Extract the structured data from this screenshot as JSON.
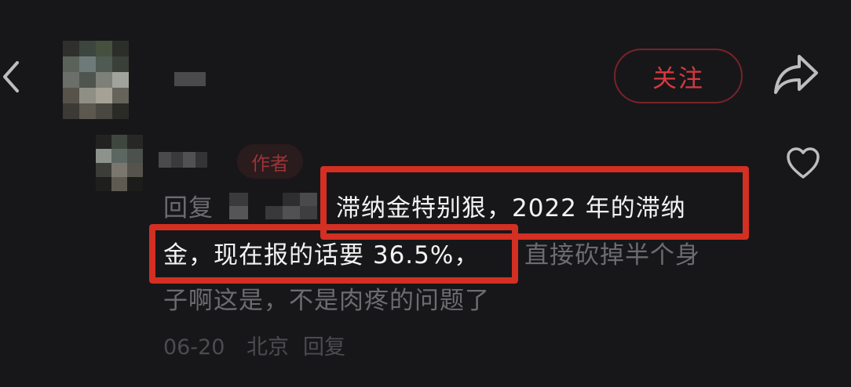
{
  "header": {
    "follow_label": "关注"
  },
  "comment": {
    "author_badge": "作者",
    "reply_prefix": "回复",
    "text_line1": "滞纳金特别狠，2022 年的滞纳",
    "text_line2a": "金，现在报的话要 36.5%，",
    "text_line2b": "直接砍掉半个身",
    "text_line3": "子啊这是，不是肉疼的问题了",
    "date": "06-20",
    "location": "北京",
    "reply_action": "回复"
  },
  "icons": {
    "back": "chevron-left-icon",
    "share": "share-arrow-icon",
    "like": "heart-outline-icon"
  },
  "colors": {
    "background": "#17171a",
    "accent_red": "#d7393f",
    "highlight_red": "#d32f22"
  }
}
